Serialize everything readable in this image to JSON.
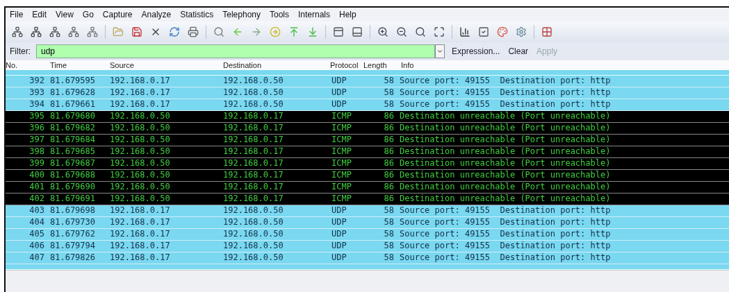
{
  "menu": [
    {
      "label": "File"
    },
    {
      "label": "Edit"
    },
    {
      "label": "View"
    },
    {
      "label": "Go"
    },
    {
      "label": "Capture"
    },
    {
      "label": "Analyze"
    },
    {
      "label": "Statistics"
    },
    {
      "label": "Telephony"
    },
    {
      "label": "Tools"
    },
    {
      "label": "Internals"
    },
    {
      "label": "Help"
    }
  ],
  "filter": {
    "label": "Filter:",
    "value": "udp",
    "buttons": [
      {
        "label": "Expression...",
        "disabled": false
      },
      {
        "label": "Clear",
        "disabled": false
      },
      {
        "label": "Apply",
        "disabled": true
      }
    ]
  },
  "table": {
    "columns": [
      "No.",
      "Time",
      "Source",
      "Destination",
      "Protocol",
      "Length",
      "Info"
    ],
    "rows": [
      {
        "kind": "udp",
        "no": "392",
        "time": "81.679595",
        "source": "192.168.0.17",
        "destination": "192.168.0.50",
        "protocol": "UDP",
        "length": "58",
        "info": "Source port: 49155  Destination port: http"
      },
      {
        "kind": "udp",
        "no": "393",
        "time": "81.679628",
        "source": "192.168.0.17",
        "destination": "192.168.0.50",
        "protocol": "UDP",
        "length": "58",
        "info": "Source port: 49155  Destination port: http"
      },
      {
        "kind": "udp",
        "no": "394",
        "time": "81.679661",
        "source": "192.168.0.17",
        "destination": "192.168.0.50",
        "protocol": "UDP",
        "length": "58",
        "info": "Source port: 49155  Destination port: http"
      },
      {
        "kind": "icmp",
        "no": "395",
        "time": "81.679680",
        "source": "192.168.0.50",
        "destination": "192.168.0.17",
        "protocol": "ICMP",
        "length": "86",
        "info": "Destination unreachable (Port unreachable)"
      },
      {
        "kind": "icmp",
        "no": "396",
        "time": "81.679682",
        "source": "192.168.0.50",
        "destination": "192.168.0.17",
        "protocol": "ICMP",
        "length": "86",
        "info": "Destination unreachable (Port unreachable)"
      },
      {
        "kind": "icmp",
        "no": "397",
        "time": "81.679684",
        "source": "192.168.0.50",
        "destination": "192.168.0.17",
        "protocol": "ICMP",
        "length": "86",
        "info": "Destination unreachable (Port unreachable)"
      },
      {
        "kind": "icmp",
        "no": "398",
        "time": "81.679685",
        "source": "192.168.0.50",
        "destination": "192.168.0.17",
        "protocol": "ICMP",
        "length": "86",
        "info": "Destination unreachable (Port unreachable)"
      },
      {
        "kind": "icmp",
        "no": "399",
        "time": "81.679687",
        "source": "192.168.0.50",
        "destination": "192.168.0.17",
        "protocol": "ICMP",
        "length": "86",
        "info": "Destination unreachable (Port unreachable)"
      },
      {
        "kind": "icmp",
        "no": "400",
        "time": "81.679688",
        "source": "192.168.0.50",
        "destination": "192.168.0.17",
        "protocol": "ICMP",
        "length": "86",
        "info": "Destination unreachable (Port unreachable)"
      },
      {
        "kind": "icmp",
        "no": "401",
        "time": "81.679690",
        "source": "192.168.0.50",
        "destination": "192.168.0.17",
        "protocol": "ICMP",
        "length": "86",
        "info": "Destination unreachable (Port unreachable)"
      },
      {
        "kind": "icmp",
        "no": "402",
        "time": "81.679691",
        "source": "192.168.0.50",
        "destination": "192.168.0.17",
        "protocol": "ICMP",
        "length": "86",
        "info": "Destination unreachable (Port unreachable)"
      },
      {
        "kind": "udp",
        "no": "403",
        "time": "81.679698",
        "source": "192.168.0.17",
        "destination": "192.168.0.50",
        "protocol": "UDP",
        "length": "58",
        "info": "Source port: 49155  Destination port: http"
      },
      {
        "kind": "udp",
        "no": "404",
        "time": "81.679730",
        "source": "192.168.0.17",
        "destination": "192.168.0.50",
        "protocol": "UDP",
        "length": "58",
        "info": "Source port: 49155  Destination port: http"
      },
      {
        "kind": "udp",
        "no": "405",
        "time": "81.679762",
        "source": "192.168.0.17",
        "destination": "192.168.0.50",
        "protocol": "UDP",
        "length": "58",
        "info": "Source port: 49155  Destination port: http"
      },
      {
        "kind": "udp",
        "no": "406",
        "time": "81.679794",
        "source": "192.168.0.17",
        "destination": "192.168.0.50",
        "protocol": "UDP",
        "length": "58",
        "info": "Source port: 49155  Destination port: http"
      },
      {
        "kind": "udp",
        "no": "407",
        "time": "81.679826",
        "source": "192.168.0.17",
        "destination": "192.168.0.50",
        "protocol": "UDP",
        "length": "58",
        "info": "Source port: 49155  Destination port: http"
      }
    ]
  }
}
